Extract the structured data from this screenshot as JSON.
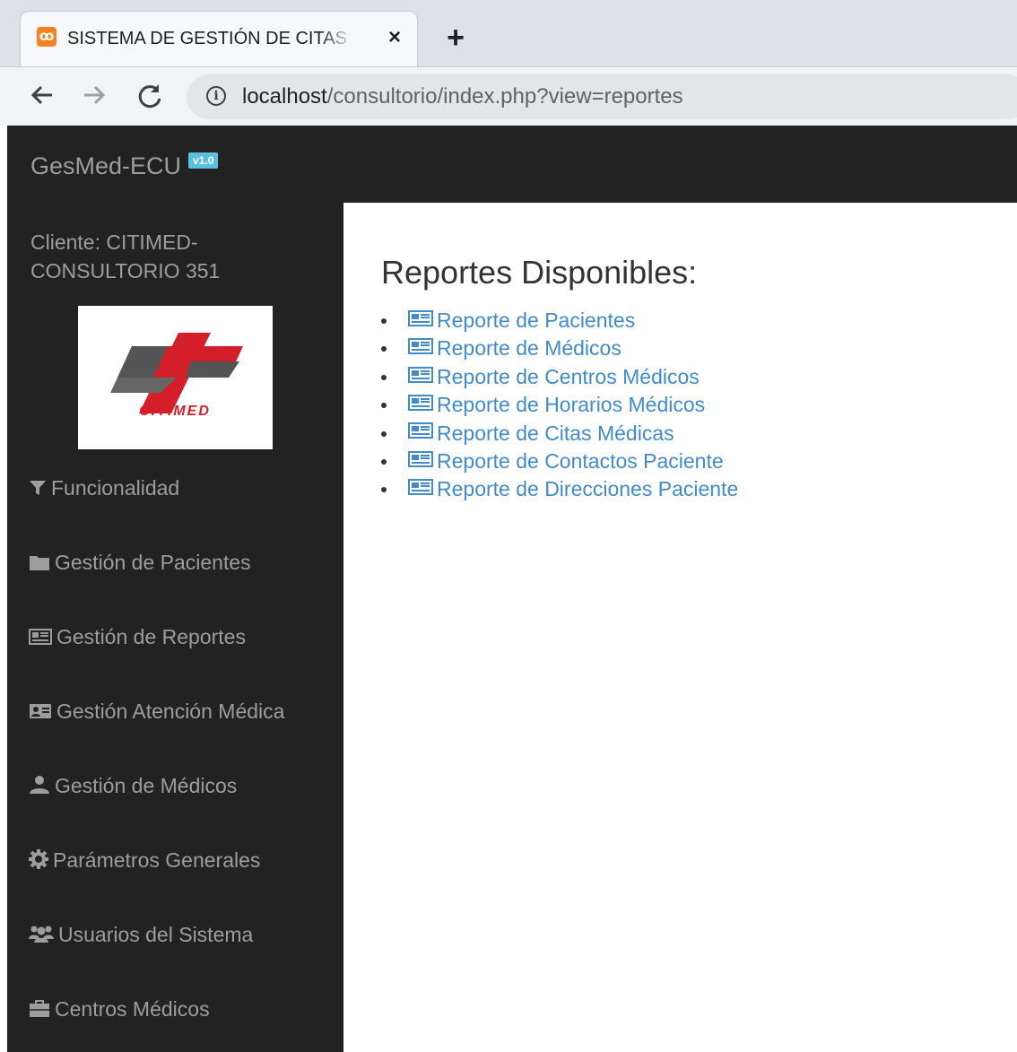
{
  "browser": {
    "tab_title": "SISTEMA DE GESTIÓN DE CITAS MÉDICAS",
    "tab_close": "×",
    "new_tab": "+",
    "favicon": "xampp-icon",
    "url_host": "localhost",
    "url_path": "/consultorio/index.php?view=reportes",
    "icons": {
      "back": "arrow-left-icon",
      "forward": "arrow-right-icon",
      "reload": "reload-icon",
      "info": "info-icon"
    }
  },
  "brand": {
    "name": "GesMed-ECU",
    "version": "v1.0",
    "badge_color": "#5bc0de"
  },
  "sidebar": {
    "client": "Cliente: CITIMED-CONSULTORIO 351",
    "logo_text": "CITIMED",
    "items": [
      {
        "label": "Funcionalidad",
        "icon": "filter-icon"
      },
      {
        "label": "Gestión de Pacientes",
        "icon": "folder-icon"
      },
      {
        "label": "Gestión de Reportes",
        "icon": "newspaper-icon"
      },
      {
        "label": "Gestión Atención Médica",
        "icon": "id-card-icon"
      },
      {
        "label": "Gestión de Médicos",
        "icon": "user-icon"
      },
      {
        "label": "Parámetros Generales",
        "icon": "cog-icon"
      },
      {
        "label": "Usuarios del Sistema",
        "icon": "users-icon"
      },
      {
        "label": "Centros Médicos",
        "icon": "briefcase-icon"
      }
    ]
  },
  "main": {
    "title": "Reportes Disponibles:",
    "reports": [
      "Reporte de Pacientes",
      "Reporte de Médicos",
      "Reporte de Centros Médicos",
      "Reporte de Horarios Médicos",
      "Reporte de Citas Médicas",
      "Reporte de Contactos Paciente",
      "Reporte de Direcciones Paciente"
    ],
    "link_color": "#428bca"
  }
}
